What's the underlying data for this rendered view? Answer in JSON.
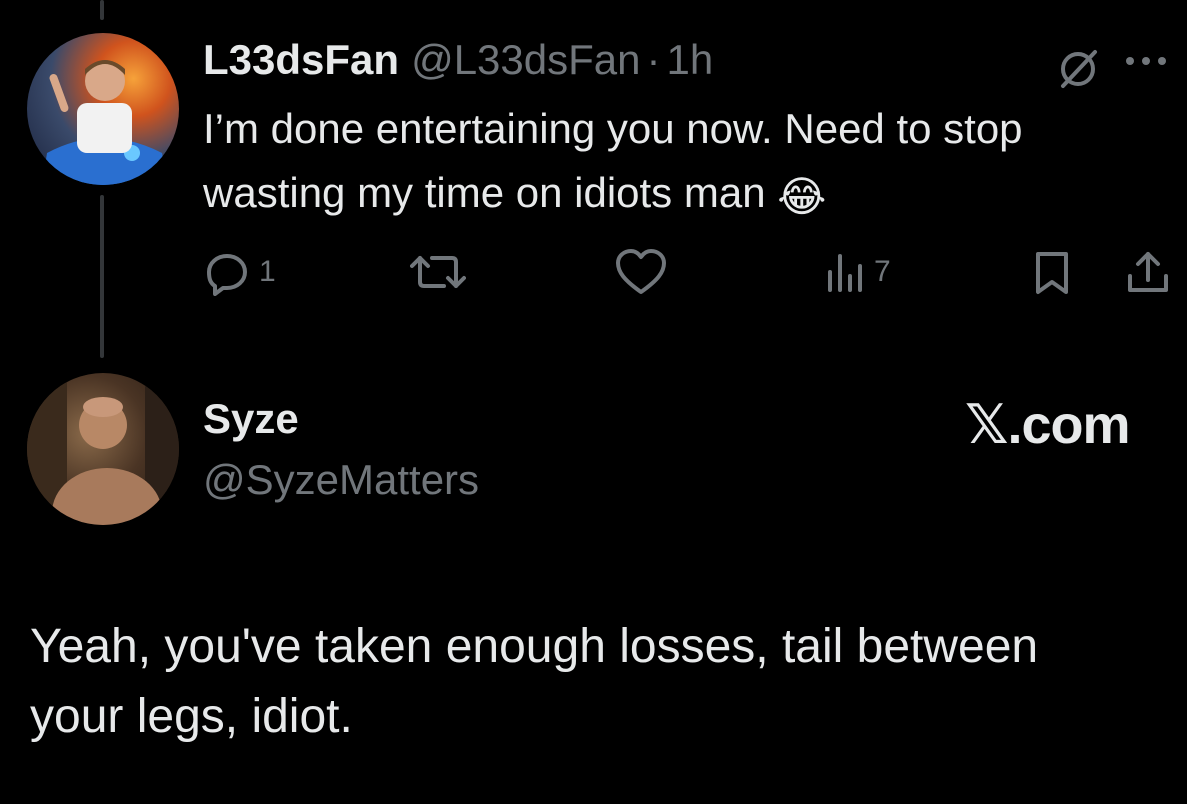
{
  "tweet": {
    "display_name": "L33dsFan",
    "handle": "@L33dsFan",
    "separator": "·",
    "time": "1h",
    "text": "I’m done entertaining you now. Need to stop wasting my time on idiots man",
    "emoji": "😂",
    "actions": {
      "replies": "1",
      "reposts": "",
      "likes": "",
      "views": "7"
    },
    "icons": [
      "no-slash-icon",
      "more-icon",
      "reply-icon",
      "repost-icon",
      "like-icon",
      "views-icon",
      "bookmark-icon",
      "share-icon"
    ],
    "accent": "#71767b"
  },
  "quoted": {
    "display_name": "Syze",
    "handle": "@SyzeMatters",
    "brand": "𝕏.com",
    "text": "Yeah, you've taken enough losses, tail between your legs, idiot."
  }
}
